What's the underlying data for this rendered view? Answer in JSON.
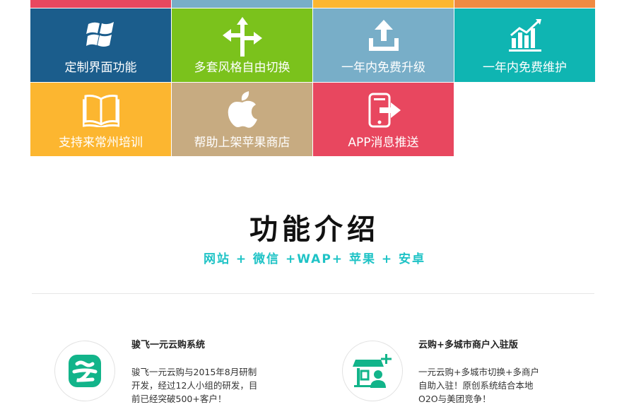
{
  "colors": {
    "tile_pink": "#e8475f",
    "tile_blue_light": "#78aec8",
    "tile_yellow": "#fcb630",
    "tile_orange": "#f08a42",
    "tile_navy": "#1b5d8c",
    "tile_green": "#7bc21c",
    "tile_teal": "#0fb5b2",
    "tile_tan": "#c7ab81",
    "accent_cyan": "#1fc3c6"
  },
  "tiles_row1": [
    {
      "label": "定制界面功能",
      "icon": "windows-icon"
    },
    {
      "label": "多套风格自由切换",
      "icon": "signpost-arrows-icon"
    },
    {
      "label": "一年内免费升级",
      "icon": "upload-icon"
    },
    {
      "label": "一年内免费维护",
      "icon": "bar-chart-icon"
    }
  ],
  "tiles_row2": [
    {
      "label": "支持来常州培训",
      "icon": "open-book-icon"
    },
    {
      "label": "帮助上架苹果商店",
      "icon": "apple-icon"
    },
    {
      "label": "APP消息推送",
      "icon": "phone-exit-icon"
    }
  ],
  "section": {
    "title": "功能介绍",
    "subtitle": "网站 + 微信 +WAP+ 苹果 + 安卓"
  },
  "features": [
    {
      "title": "骏飞一元云购系统",
      "desc_lines": [
        "骏飞一元云购与2015年8月研制",
        "开发，经过12人小组的研发，目",
        "前已经突破500+客户！"
      ],
      "icon": "cloud-yun-icon"
    },
    {
      "title": "云购+多城市商户入驻版",
      "desc_lines": [
        "一元云购+多城市切换+多商户",
        "自助入驻！原创系统结合本地",
        "O2O与美团竞争！"
      ],
      "icon": "storefront-user-icon"
    }
  ]
}
